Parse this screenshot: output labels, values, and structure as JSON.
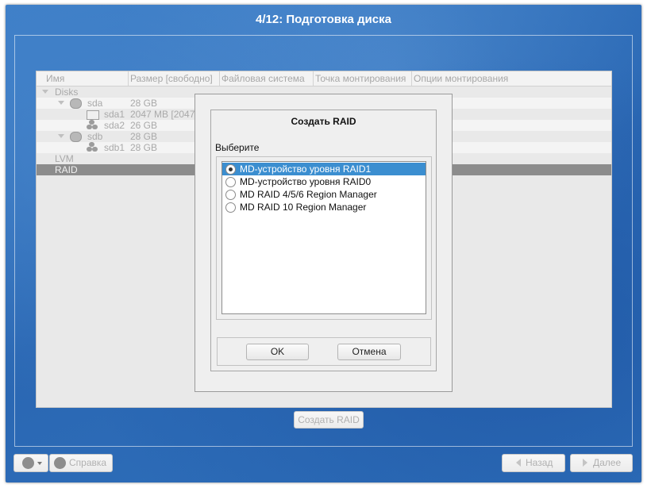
{
  "window": {
    "title": "4/12: Подготовка диска"
  },
  "tree": {
    "columns": [
      "Имя",
      "Размер [свободно]",
      "Файловая система",
      "Точка монтирования",
      "Опции монтирования"
    ],
    "rows": [
      {
        "name": "Disks",
        "size": ""
      },
      {
        "name": "sda",
        "size": "28 GB"
      },
      {
        "name": "sda1",
        "size": "2047 MB [2047"
      },
      {
        "name": "sda2",
        "size": "26 GB"
      },
      {
        "name": "sdb",
        "size": "28 GB"
      },
      {
        "name": "sdb1",
        "size": "28 GB"
      },
      {
        "name": "LVM",
        "size": ""
      },
      {
        "name": "RAID",
        "size": ""
      }
    ]
  },
  "create_raid_button": "Создать RAID",
  "dialog": {
    "title": "Создать RAID",
    "prompt": "Выберите",
    "options": [
      "MD-устройство уровня RAID1",
      "MD-устройство уровня RAID0",
      "MD RAID 4/5/6 Region Manager",
      "MD RAID 10 Region Manager"
    ],
    "selected_index": 0,
    "ok_label": "OK",
    "cancel_label": "Отмена"
  },
  "footer": {
    "help_label": "Справка",
    "back_label": "Назад",
    "next_label": "Далее"
  },
  "colors": {
    "background_blue": "#2f6fba",
    "selection_blue": "#3b8ed0",
    "selected_row_gray": "#8c8c8c"
  }
}
